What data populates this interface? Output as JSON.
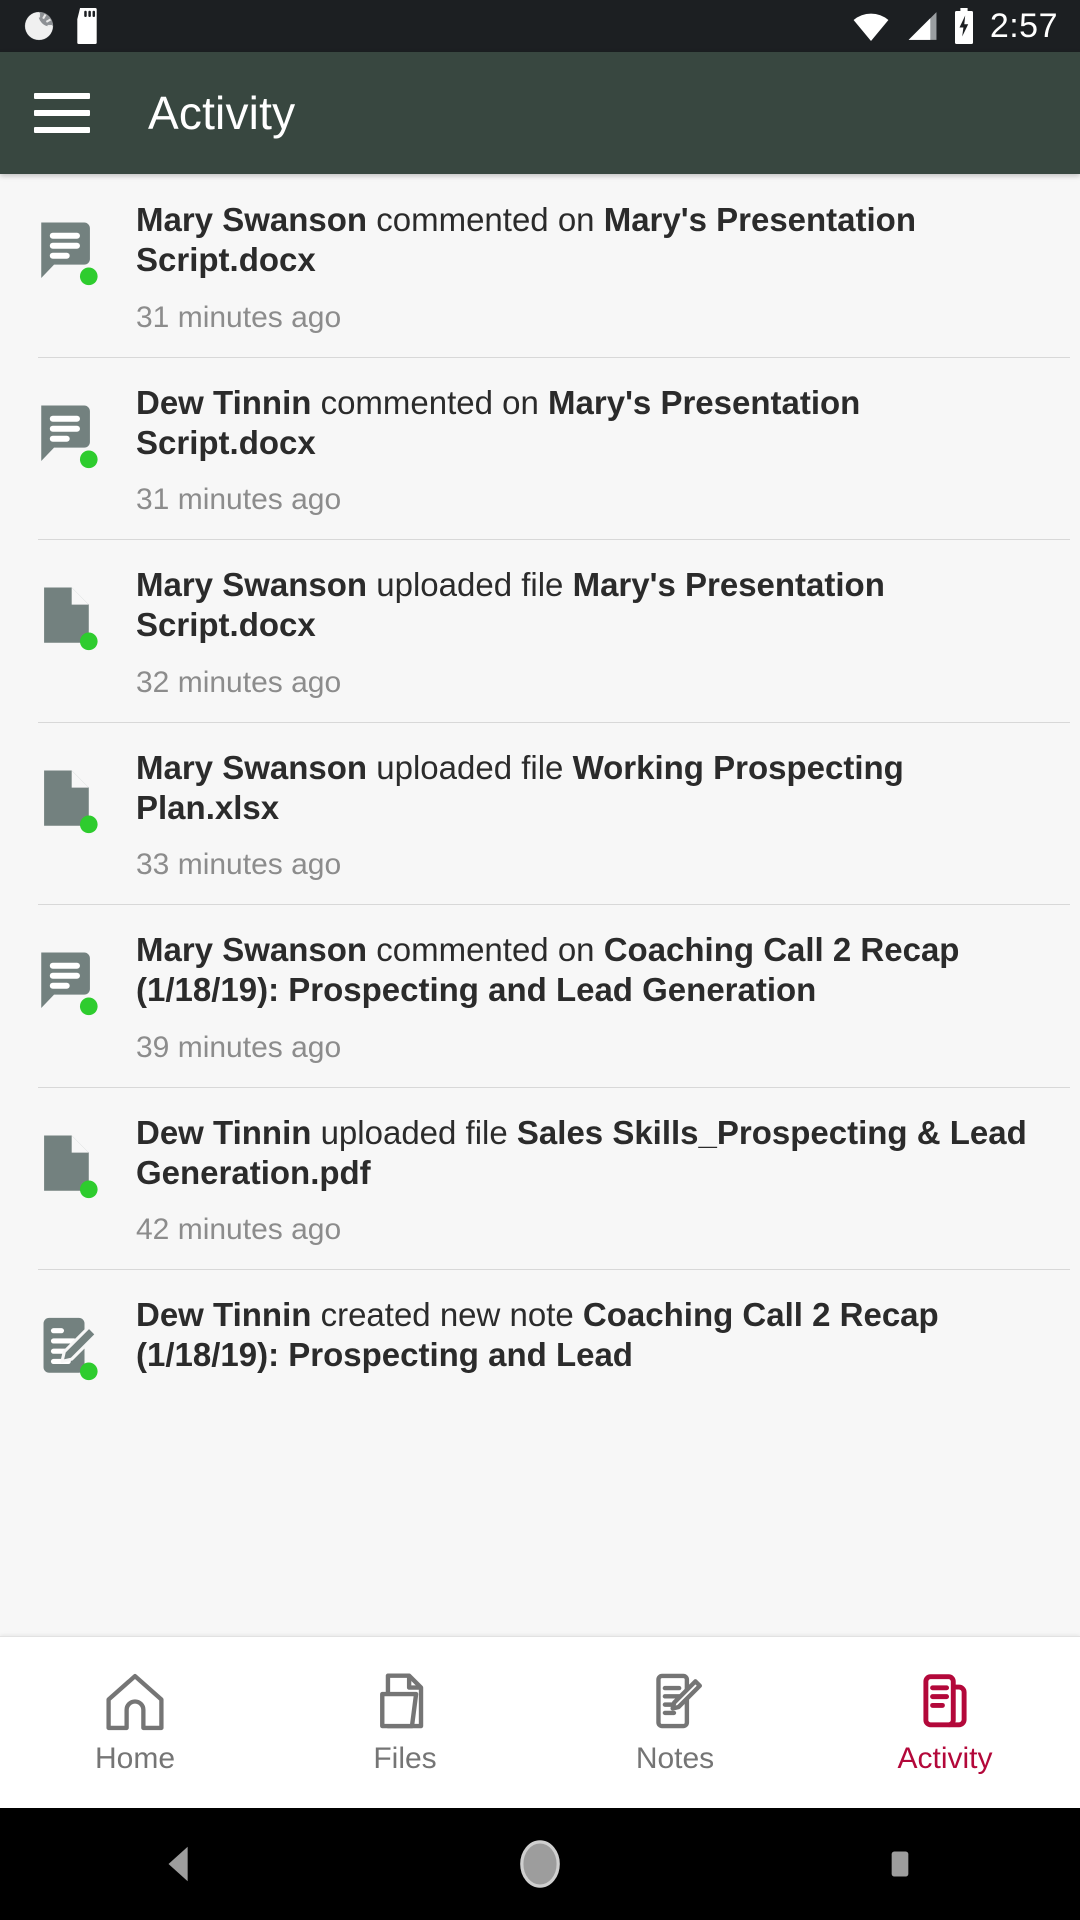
{
  "status_bar": {
    "time": "2:57",
    "icons": [
      "sync-spinner-icon",
      "sd-card-icon",
      "wifi-icon",
      "cell-signal-icon",
      "battery-charging-icon"
    ]
  },
  "app_bar": {
    "title": "Activity",
    "menu_icon": "hamburger-menu-icon",
    "background_color": "#384740"
  },
  "activity": {
    "items": [
      {
        "icon": "comment-icon",
        "actor": "Mary Swanson",
        "verb": " commented on ",
        "target": "Mary's Presentation Script.docx",
        "time": "31 minutes ago"
      },
      {
        "icon": "comment-icon",
        "actor": "Dew Tinnin",
        "verb": " commented on ",
        "target": "Mary's Presentation Script.docx",
        "time": "31 minutes ago"
      },
      {
        "icon": "file-icon",
        "actor": "Mary Swanson",
        "verb": " uploaded file ",
        "target": "Mary's Presentation Script.docx",
        "time": "32 minutes ago"
      },
      {
        "icon": "file-icon",
        "actor": "Mary Swanson",
        "verb": " uploaded file ",
        "target": "Working Prospecting Plan.xlsx",
        "time": "33 minutes ago"
      },
      {
        "icon": "comment-icon",
        "actor": "Mary Swanson",
        "verb": " commented on ",
        "target": "Coaching Call 2 Recap (1/18/19): Prospecting and Lead Generation",
        "time": "39 minutes ago"
      },
      {
        "icon": "file-icon",
        "actor": "Dew Tinnin",
        "verb": " uploaded file ",
        "target": "Sales Skills_Prospecting & Lead Generation.pdf",
        "time": "42 minutes ago"
      },
      {
        "icon": "note-icon",
        "actor": "Dew Tinnin",
        "verb": " created new note ",
        "target": "Coaching Call 2 Recap (1/18/19): Prospecting and Lead",
        "time": ""
      }
    ],
    "badge_color": "#2ecc2e",
    "icon_color": "#73817f"
  },
  "bottom_nav": {
    "active_color": "#b3083a",
    "inactive_color": "#757575",
    "items": [
      {
        "label": "Home",
        "icon": "home-icon",
        "active": false
      },
      {
        "label": "Files",
        "icon": "files-icon",
        "active": false
      },
      {
        "label": "Notes",
        "icon": "notes-icon",
        "active": false
      },
      {
        "label": "Activity",
        "icon": "activity-icon",
        "active": true
      }
    ]
  },
  "system_nav": {
    "back": "back-triangle-icon",
    "home": "home-circle-icon",
    "recents": "recents-square-icon"
  }
}
